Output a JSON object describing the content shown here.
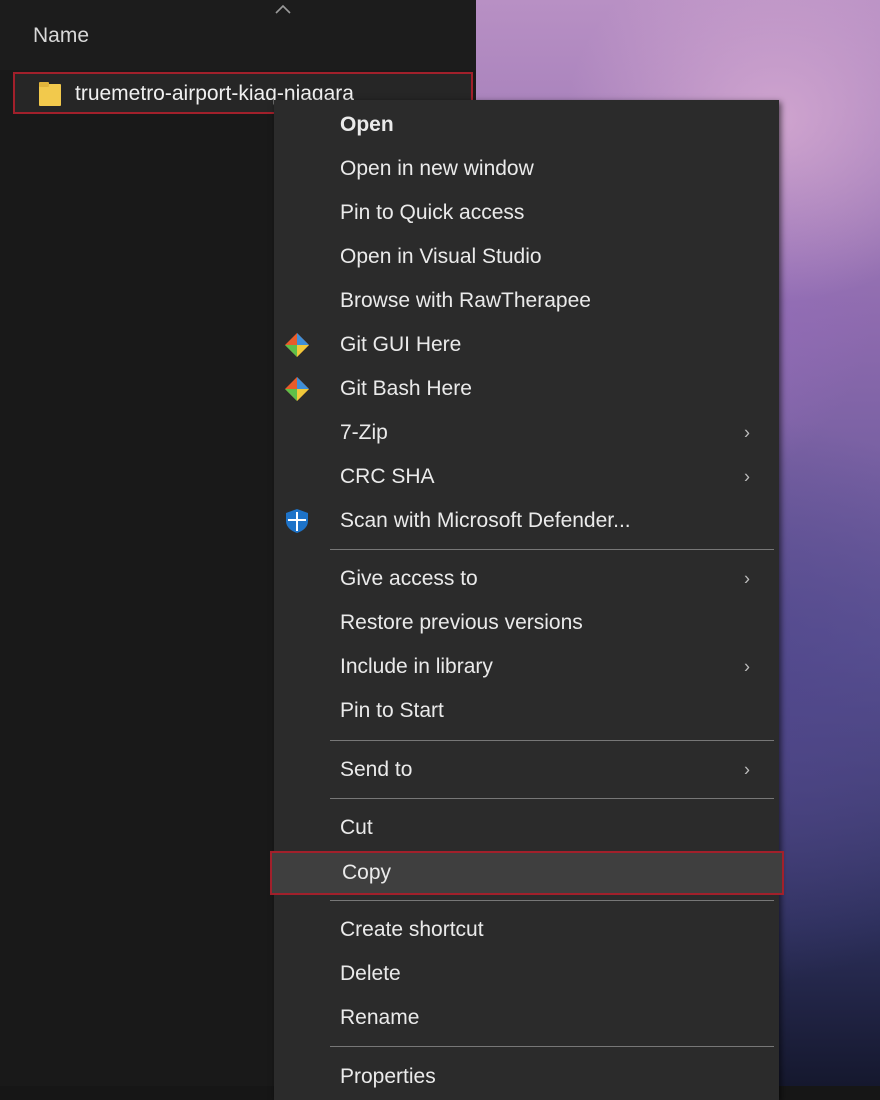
{
  "explorer": {
    "column_header": "Name",
    "selected_item": "truemetro-airport-kiaq-niagara"
  },
  "context_menu": {
    "items": [
      {
        "label": "Open",
        "bold": true
      },
      {
        "label": "Open in new window"
      },
      {
        "label": "Pin to Quick access"
      },
      {
        "label": "Open in Visual Studio"
      },
      {
        "label": "Browse with RawTherapee"
      },
      {
        "label": "Git GUI Here",
        "icon": "git-gui-icon"
      },
      {
        "label": "Git Bash Here",
        "icon": "git-bash-icon"
      },
      {
        "label": "7-Zip",
        "submenu": true
      },
      {
        "label": "CRC SHA",
        "submenu": true
      },
      {
        "label": "Scan with Microsoft Defender...",
        "icon": "defender-shield-icon"
      },
      {
        "label": "Give access to",
        "submenu": true
      },
      {
        "label": "Restore previous versions"
      },
      {
        "label": "Include in library",
        "submenu": true
      },
      {
        "label": "Pin to Start"
      },
      {
        "label": "Send to",
        "submenu": true
      },
      {
        "label": "Cut"
      },
      {
        "label": "Copy",
        "highlighted": true
      },
      {
        "label": "Create shortcut"
      },
      {
        "label": "Delete"
      },
      {
        "label": "Rename"
      },
      {
        "label": "Properties"
      }
    ],
    "submenu_arrow": "›"
  },
  "colors": {
    "highlight_border": "#a1202b",
    "folder_yellow": "#f2c94c",
    "defender_blue": "#1e73c8"
  }
}
